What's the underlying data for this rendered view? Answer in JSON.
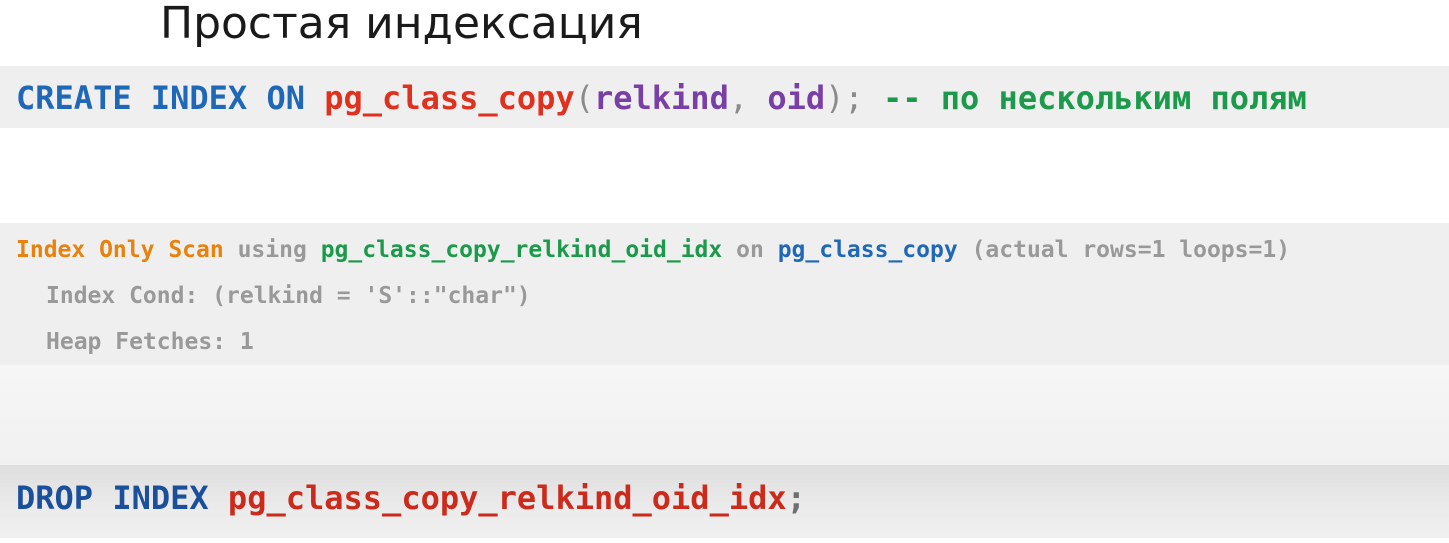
{
  "title": "Простая индексация",
  "create_statement": {
    "create": "CREATE",
    "index": "INDEX",
    "on": "ON",
    "table": "pg_class_copy",
    "open_paren": "(",
    "col1": "relkind",
    "comma": ", ",
    "col2": "oid",
    "close": ");",
    "comment": "-- по нескольким полям"
  },
  "plan": {
    "node": "Index Only Scan",
    "using": "using",
    "index_name": "pg_class_copy_relkind_oid_idx",
    "on": "on",
    "table": "pg_class_copy",
    "stats": "(actual rows=1 loops=1)",
    "cond": "Index Cond: (relkind = 'S'::\"char\")",
    "heap": "Heap Fetches: 1"
  },
  "drop_statement": {
    "drop": "DROP",
    "index": "INDEX",
    "index_name": "pg_class_copy_relkind_oid_idx",
    "semicolon": ";"
  },
  "colors": {
    "keyword_blue": "#1f68b8",
    "identifier_red": "#e0301e",
    "column_purple": "#7a3fa6",
    "comment_green": "#1a9a4a",
    "plan_node_orange": "#e8820c",
    "plan_text_gray": "#999999",
    "band_background": "#efefef"
  }
}
